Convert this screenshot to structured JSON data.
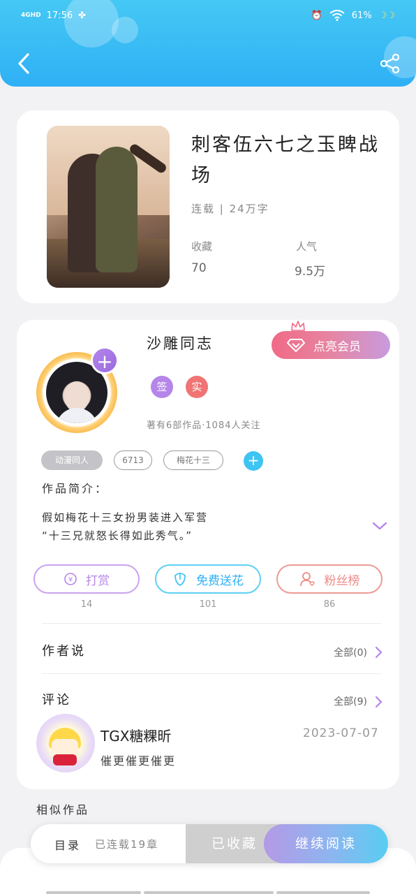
{
  "status_bar": {
    "network": "4GHD",
    "time": "17:56",
    "battery": "61%"
  },
  "book": {
    "title": "刺客伍六七之玉睥战场",
    "status": "连载 | 24万字",
    "favorites_label": "收藏",
    "favorites_value": "70",
    "popularity_label": "人气",
    "popularity_value": "9.5万"
  },
  "author": {
    "name": "沙雕同志",
    "vip_button": "点亮会员",
    "badge_sign": "签",
    "badge_real": "实",
    "works_info": "著有6部作品·1084人关注"
  },
  "tags": [
    "动漫同人",
    "6713",
    "梅花十三"
  ],
  "intro": {
    "label": "作品简介：",
    "line1": "假如梅花十三女扮男装进入军营",
    "line2": "“十三兄就怒长得如此秀气。”"
  },
  "actions": [
    {
      "label": "打赏",
      "count": "14"
    },
    {
      "label": "免费送花",
      "count": "101"
    },
    {
      "label": "粉丝榜",
      "count": "86"
    }
  ],
  "author_says": {
    "title": "作者说",
    "more": "全部(0)"
  },
  "comments": {
    "title": "评论",
    "more": "全部(9)",
    "items": [
      {
        "user": "TGX糖粿昕",
        "date": "2023-07-07",
        "text": "催更催更催更"
      }
    ]
  },
  "similar": {
    "title": "相似作品"
  },
  "bottom_bar": {
    "toc": "目录",
    "chapters": "已连载19章",
    "favorited": "已收藏",
    "continue": "继续阅读"
  },
  "colors": {
    "header": "#2fb0f5",
    "vip_pink": "#f06a86",
    "purple": "#b585ea",
    "cyan": "#3ec4f2",
    "salmon": "#ee8a86"
  }
}
